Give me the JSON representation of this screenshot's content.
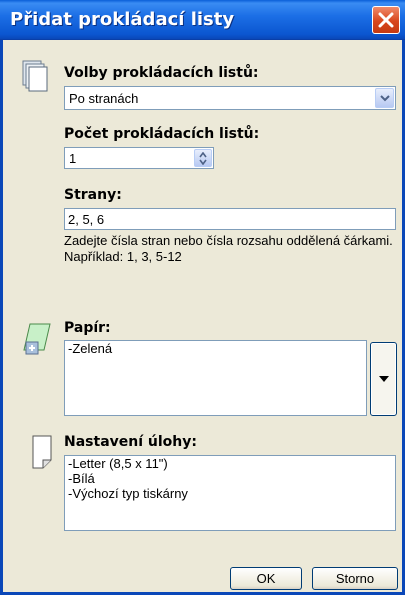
{
  "window": {
    "title": "Přidat prokládací listy"
  },
  "inserts_options": {
    "label": "Volby prokládacích listů:",
    "selected": "Po stranách"
  },
  "count": {
    "label": "Počet prokládacích listů:",
    "value": "1"
  },
  "pages": {
    "label": "Strany:",
    "value": "2, 5, 6",
    "hint": "Zadejte čísla stran nebo čísla rozsahu oddělená čárkami.",
    "example": "Například: 1, 3, 5-12"
  },
  "paper": {
    "label": "Papír:",
    "items": [
      "-Zelená"
    ]
  },
  "job_settings": {
    "label": "Nastavení úlohy:",
    "items": [
      "-Letter (8,5 x 11\")",
      "-Bílá",
      "-Výchozí typ tiskárny"
    ]
  },
  "buttons": {
    "ok": "OK",
    "cancel": "Storno"
  },
  "colors": {
    "titlebar": "#0a5fd8",
    "window_bg": "#ece9d8",
    "close": "#d8461d"
  },
  "icons": {
    "inserts": "stacked-pages-icon",
    "paper": "paper-sheet-icon",
    "job": "document-icon",
    "close": "close-icon"
  }
}
